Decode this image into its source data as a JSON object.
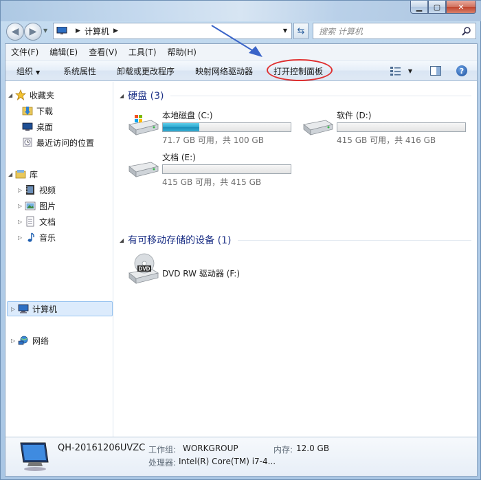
{
  "address": {
    "path": "计算机"
  },
  "search": {
    "placeholder": "搜索 计算机"
  },
  "menu": [
    "文件(F)",
    "编辑(E)",
    "查看(V)",
    "工具(T)",
    "帮助(H)"
  ],
  "commands": [
    "组织",
    "系统属性",
    "卸载或更改程序",
    "映射网络驱动器",
    "打开控制面板"
  ],
  "nav": {
    "favorites": "收藏夹",
    "downloads": "下载",
    "desktop": "桌面",
    "recent": "最近访问的位置",
    "libraries": "库",
    "videos": "视频",
    "pictures": "图片",
    "documents": "文档",
    "music": "音乐",
    "computer": "计算机",
    "network": "网络"
  },
  "groups": {
    "hdd": "硬盘 (3)",
    "removable": "有可移动存储的设备 (1)"
  },
  "drives": [
    {
      "name": "本地磁盘 (C:)",
      "info": "71.7 GB 可用，共 100 GB",
      "used_fraction": 0.283
    },
    {
      "name": "软件 (D:)",
      "info": "415 GB 可用，共 416 GB",
      "used_fraction": 0.002
    },
    {
      "name": "文档 (E:)",
      "info": "415 GB 可用，共 415 GB",
      "used_fraction": 0.0
    }
  ],
  "dvd": {
    "name": "DVD RW 驱动器 (F:)",
    "label": "DVD"
  },
  "details": {
    "computer_name": "QH-20161206UVZC",
    "workgroup_label": "工作组:",
    "workgroup": "WORKGROUP",
    "memory_label": "内存:",
    "memory": "12.0 GB",
    "cpu_label": "处理器:",
    "cpu": "Intel(R) Core(TM) i7-4..."
  },
  "colors": {
    "annotation_circle": "#e03030",
    "annotation_arrow": "#3a64c8",
    "usage_bar": "#2aa6cf"
  }
}
